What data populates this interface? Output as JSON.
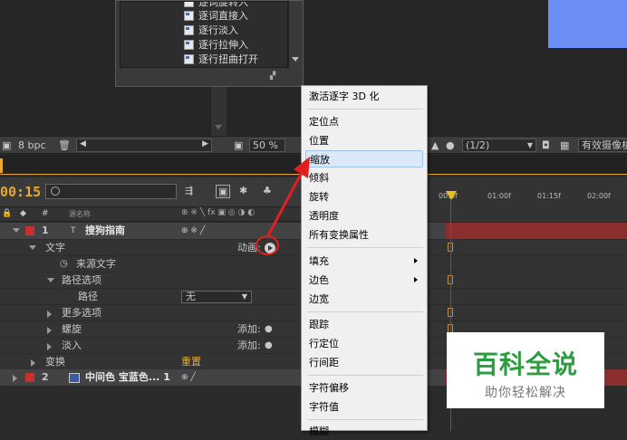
{
  "presets": {
    "items": [
      "逐词旋转入",
      "逐词直接入",
      "逐行淡入",
      "逐行拉伸入",
      "逐行扭曲打开"
    ]
  },
  "viewer_bar": {
    "bpc": "8 bpc",
    "zoom": "50 %",
    "resolution": "(1/2)",
    "view_mode": "有效摄像机"
  },
  "timeline": {
    "current_time": "00:15",
    "source_name_header": "源名称",
    "ruler_labels": [
      "00:0f",
      "01:00f",
      "01:15f",
      "02:00f"
    ]
  },
  "layers": {
    "layer1": {
      "number": "1",
      "name": "搜狗指南"
    },
    "text": {
      "label": "文字",
      "animate_label": "动画:"
    },
    "source_text": "来源文字",
    "path_options": "路径选项",
    "path": {
      "label": "路径",
      "value": "无"
    },
    "more_options": "更多选项",
    "wiggle": {
      "label": "螺旋",
      "add_label": "添加:"
    },
    "fade_in": {
      "label": "淡入",
      "add_label": "添加:"
    },
    "transform": {
      "label": "变换",
      "reset": "重置"
    },
    "layer2": {
      "number": "2",
      "name": "中间色 宝蓝色... 1"
    }
  },
  "context_menu": {
    "items": [
      "激活逐字 3D 化",
      "定位点",
      "位置",
      "缩放",
      "倾斜",
      "旋转",
      "透明度",
      "所有变换属性",
      "填充",
      "边色",
      "边宽",
      "跟踪",
      "行定位",
      "行间距",
      "字符偏移",
      "字符值",
      "模糊"
    ],
    "highlighted": "缩放"
  },
  "watermark": {
    "title": "百科全说",
    "subtitle": "助你轻松解决"
  },
  "colors": {
    "accent_orange": "#e8a832",
    "label_red": "#c83030",
    "annotation_red": "#e02020",
    "watermark_green": "#2e9c40",
    "blue_swatch": "#6b8ff5"
  }
}
